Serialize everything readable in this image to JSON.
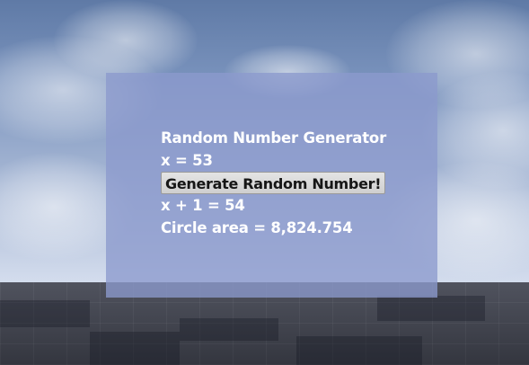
{
  "widget": {
    "title": "Random Number Generator",
    "x_line": "x = 53",
    "button_label": "Generate Random Number!",
    "x_plus_one_line": "x + 1 = 54",
    "circle_area_line": "Circle area = 8,824.754"
  },
  "colors": {
    "panel_overlay": "#8c9acd",
    "text": "#ffffff",
    "button_bg": "#d9d9d9",
    "button_text": "#161616",
    "ground": "#454854"
  }
}
